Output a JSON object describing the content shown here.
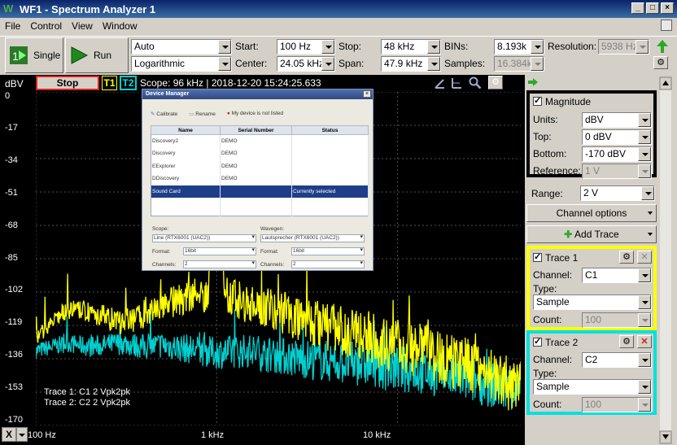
{
  "window": {
    "title": "WF1 - Spectrum Analyzer 1",
    "icon": "W"
  },
  "menu": [
    "File",
    "Control",
    "View",
    "Window"
  ],
  "toolbar": {
    "single_label": "Single",
    "run_label": "Run",
    "mode": "Auto",
    "scale": "Logarithmic",
    "start_label": "Start:",
    "start": "100 Hz",
    "center_label": "Center:",
    "center": "24.05 kHz",
    "stop_label": "Stop:",
    "stop": "48 kHz",
    "span_label": "Span:",
    "span": "47.9 kHz",
    "bins_label": "BINs:",
    "bins": "8.193k",
    "samples_label": "Samples:",
    "samples": "16.384k",
    "resolution_label": "Resolution:",
    "resolution": "5938 Hz"
  },
  "scope": {
    "unit": "dBV",
    "stop_label": "Stop",
    "t1": "T1",
    "t2": "T2",
    "info": "Scope: 96 kHz | 2018-12-20 15:24:25.633",
    "y_ticks": [
      "0",
      "-17",
      "-34",
      "-51",
      "-68",
      "-85",
      "-102",
      "-119",
      "-136",
      "-153",
      "-170"
    ],
    "x_ticks": [
      "100 Hz",
      "1 kHz",
      "10 kHz"
    ],
    "legend": [
      "Trace 1: C1 2 Vpk2pk",
      "Trace 2: C2 2 Vpk2pk"
    ],
    "axis_selector": "X",
    "colors": {
      "trace1": "#ffff00",
      "trace2": "#00d0d0",
      "grid": "#505050"
    }
  },
  "chart_data": {
    "type": "line",
    "xlabel": "",
    "ylabel": "dBV",
    "x_scale": "log",
    "xlim": [
      100,
      48000
    ],
    "ylim": [
      -170,
      0
    ],
    "grid": true,
    "series": [
      {
        "name": "Trace 1",
        "color": "#ffff00",
        "x": [
          100,
          150,
          200,
          300,
          400,
          500,
          700,
          900,
          950,
          1000,
          1050,
          1100,
          1500,
          2000,
          3000,
          5000,
          7000,
          10000,
          15000,
          20000,
          30000,
          40000,
          48000
        ],
        "y": [
          -125,
          -111,
          -112,
          -118,
          -113,
          -108,
          -105,
          -103,
          -20,
          -3,
          -40,
          -103,
          -108,
          -110,
          -116,
          -122,
          -126,
          -130,
          -133,
          -137,
          -141,
          -148,
          -151
        ]
      },
      {
        "name": "Trace 2",
        "color": "#00d0d0",
        "x": [
          100,
          150,
          200,
          300,
          400,
          500,
          700,
          1000,
          1500,
          2000,
          3000,
          5000,
          7000,
          10000,
          15000,
          20000,
          30000,
          40000,
          48000
        ],
        "y": [
          -132,
          -128,
          -130,
          -128,
          -130,
          -129,
          -131,
          -133,
          -132,
          -134,
          -136,
          -138,
          -139,
          -141,
          -143,
          -145,
          -148,
          -151,
          -153
        ]
      }
    ]
  },
  "device_manager": {
    "title": "Device Manager",
    "tools": [
      "Calibrate",
      "Rename",
      "My device is not listed"
    ],
    "columns": [
      "Name",
      "Serial Number",
      "Status"
    ],
    "rows": [
      [
        "Discovery2",
        "DEMO",
        ""
      ],
      [
        "Discovery",
        "DEMO",
        ""
      ],
      [
        "EExplorer",
        "DEMO",
        ""
      ],
      [
        "DDiscovery",
        "DEMO",
        ""
      ],
      [
        "Sound Card",
        "",
        "Currently selected"
      ]
    ],
    "scope_label": "Scope:",
    "scope_value": "Line (RTX6001 (UAC2))",
    "wavegen_label": "Wavegen:",
    "wavegen_value": "Lautsprecher (RTX6001 (UAC2))",
    "format_label": "Format:",
    "format_value": "16bit",
    "format_value2": "16bit",
    "channels_label": "Channels:",
    "channels_value": "2",
    "channels_value2": "2"
  },
  "panel": {
    "magnitude": {
      "title": "Magnitude",
      "units_label": "Units:",
      "units": "dBV",
      "top_label": "Top:",
      "top": "0 dBV",
      "bottom_label": "Bottom:",
      "bottom": "-170 dBV",
      "reference_label": "Reference:",
      "reference": "1 V"
    },
    "range_label": "Range:",
    "range": "2 V",
    "channel_options": "Channel options",
    "add_trace": "Add Trace",
    "trace1": {
      "title": "Trace 1",
      "channel_label": "Channel:",
      "channel": "C1",
      "type_label": "Type:",
      "type": "Sample",
      "count_label": "Count:",
      "count": "100"
    },
    "trace2": {
      "title": "Trace 2",
      "channel_label": "Channel:",
      "channel": "C2",
      "type_label": "Type:",
      "type": "Sample",
      "count_label": "Count:",
      "count": "100"
    }
  }
}
